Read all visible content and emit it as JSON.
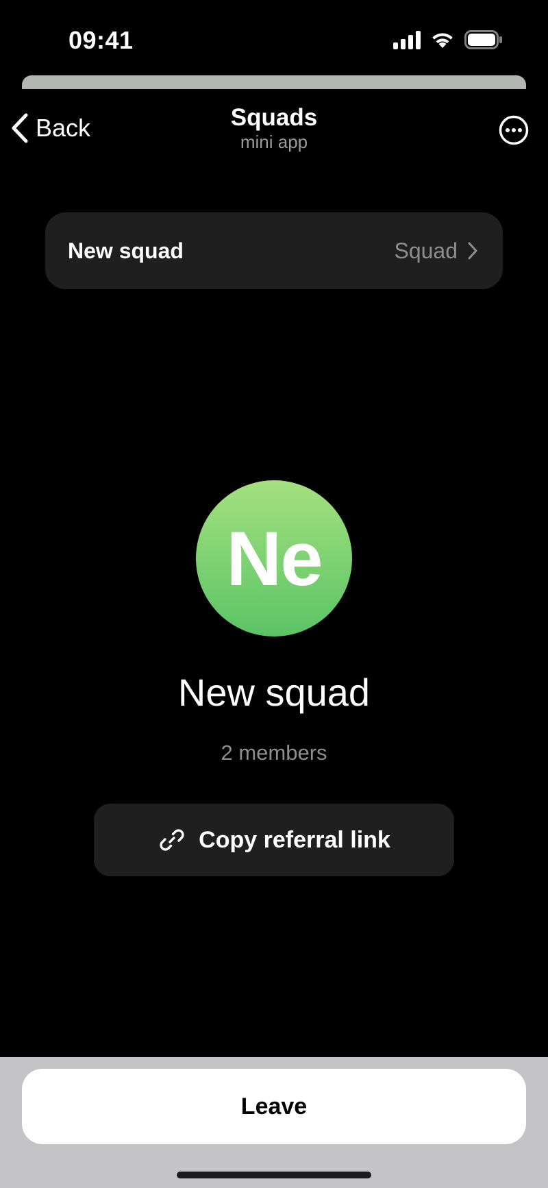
{
  "status_bar": {
    "time": "09:41"
  },
  "header": {
    "back_label": "Back",
    "title": "Squads",
    "subtitle": "mini app"
  },
  "squad_selector": {
    "name": "New squad",
    "type": "Squad"
  },
  "profile": {
    "initials": "Ne",
    "name": "New squad",
    "members": "2 members"
  },
  "actions": {
    "copy_referral": "Copy referral link",
    "leave": "Leave"
  },
  "colors": {
    "background": "#000000",
    "card": "#1f1f1f",
    "avatar_gradient_top": "#a4e07f",
    "avatar_gradient_bottom": "#5bc466",
    "secondary_text": "#8e8e8e",
    "bottom_panel": "#c4c4c6"
  },
  "icons": {
    "back": "chevron-left-icon",
    "more": "more-horizontal-circle-icon",
    "row_arrow": "chevron-right-icon",
    "copy": "link-icon"
  }
}
